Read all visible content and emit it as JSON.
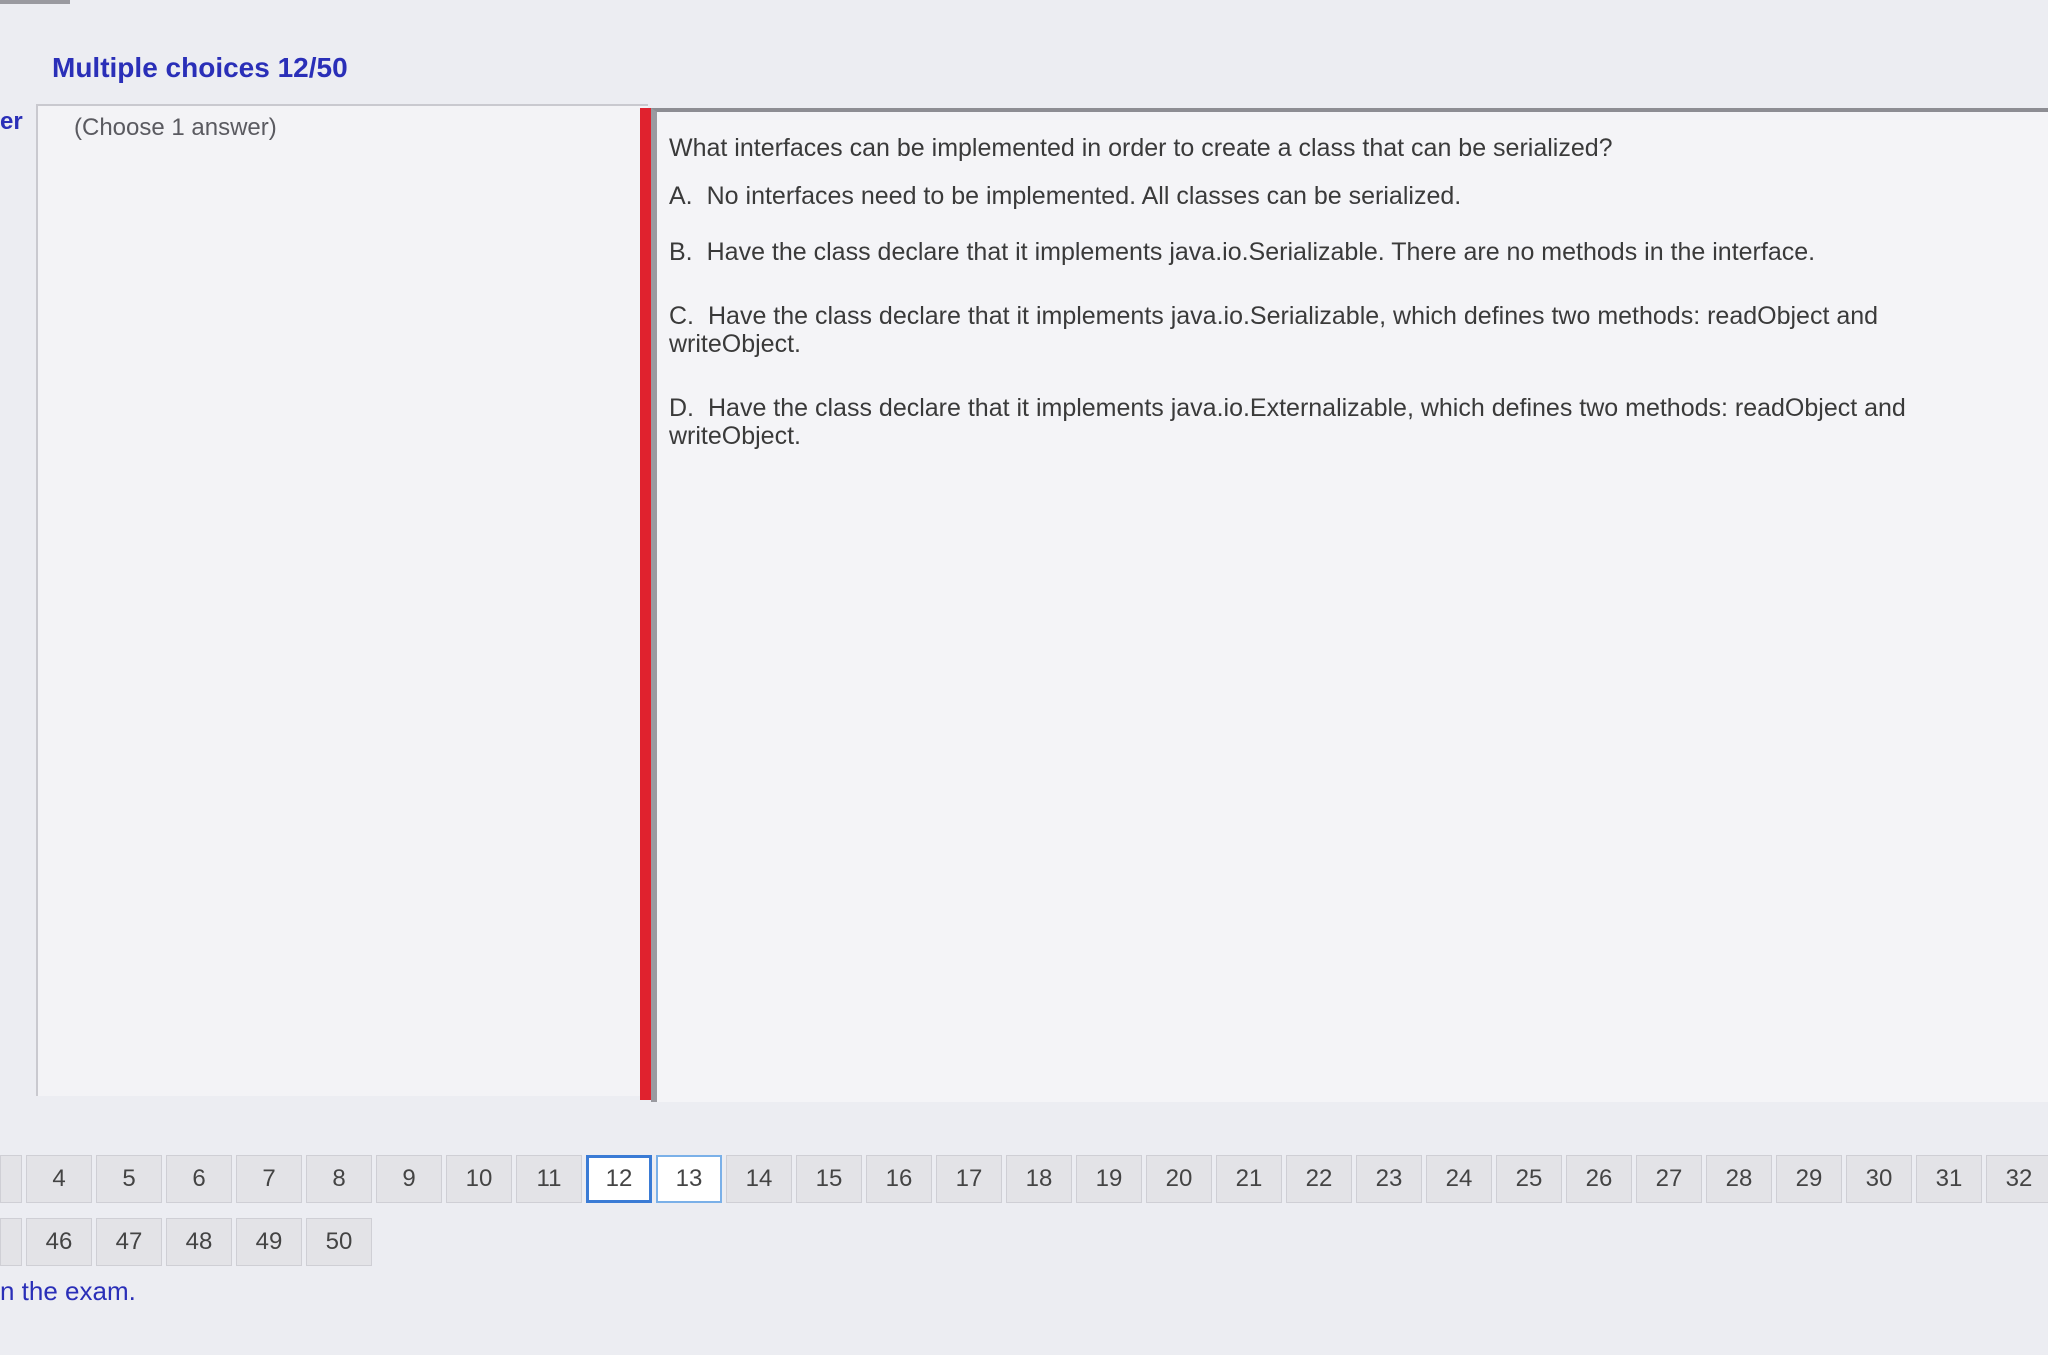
{
  "header": {
    "title": "Multiple choices 12/50",
    "side_fragment": "er"
  },
  "left_panel": {
    "hint": "(Choose 1 answer)"
  },
  "question": {
    "text": "What interfaces can be implemented in order to create a class that can be serialized?",
    "options": [
      {
        "letter": "A.",
        "text": "No interfaces need to be implemented. All classes can be serialized."
      },
      {
        "letter": "B.",
        "text": "Have the class declare that it implements java.io.Serializable. There are no methods in the interface."
      },
      {
        "letter": "C.",
        "text": "Have the class declare that it implements java.io.Serializable, which defines two methods: readObject and writeObject."
      },
      {
        "letter": "D.",
        "text": "Have the class declare that it implements java.io.Externalizable, which defines two methods: readObject and writeObject."
      }
    ]
  },
  "navigation": {
    "row1": [
      "4",
      "5",
      "6",
      "7",
      "8",
      "9",
      "10",
      "11",
      "12",
      "13",
      "14",
      "15",
      "16",
      "17",
      "18",
      "19",
      "20",
      "21",
      "22",
      "23",
      "24",
      "25",
      "26",
      "27",
      "28",
      "29",
      "30",
      "31",
      "32"
    ],
    "row2": [
      "46",
      "47",
      "48",
      "49",
      "50"
    ],
    "current": "12",
    "hovered": "13"
  },
  "footer": {
    "exam_link": "n the exam."
  }
}
